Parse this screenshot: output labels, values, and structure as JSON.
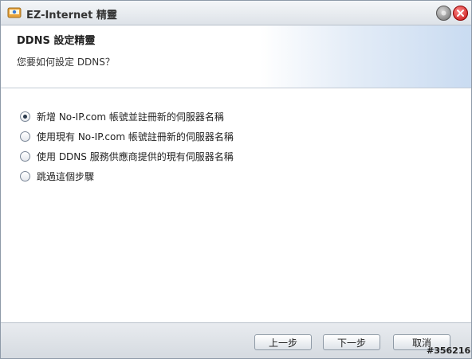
{
  "window": {
    "title": "EZ-Internet 精靈"
  },
  "header": {
    "title": "DDNS 設定精靈",
    "subtitle": "您要如何設定 DDNS？"
  },
  "options": [
    {
      "label": "新增 No-IP.com 帳號並註冊新的伺服器名稱",
      "checked": true
    },
    {
      "label": "使用現有 No-IP.com 帳號註冊新的伺服器名稱",
      "checked": false
    },
    {
      "label": "使用 DDNS 服務供應商提供的現有伺服器名稱",
      "checked": false
    },
    {
      "label": "跳過這個步驟",
      "checked": false
    }
  ],
  "footer": {
    "prev_label": "上一步",
    "next_label": "下一步",
    "cancel_label": "取消"
  },
  "watermark": "#356216"
}
